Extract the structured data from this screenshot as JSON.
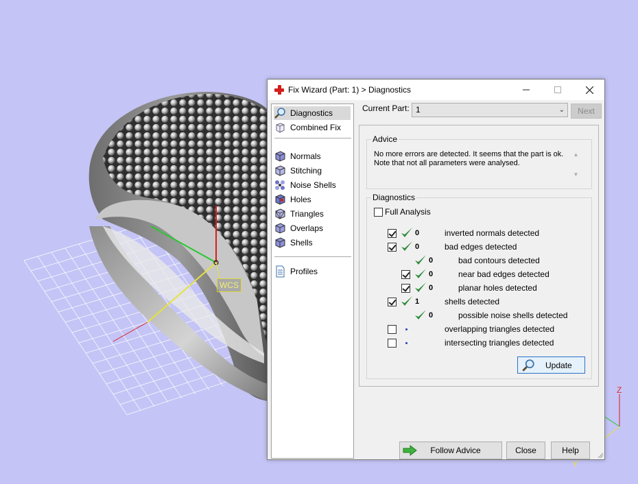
{
  "viewport": {
    "wcs_label": "WCS",
    "axis_z": "Z",
    "axis_y": "Y"
  },
  "dialog": {
    "title": "Fix Wizard (Part: 1) > Diagnostics",
    "icons": {
      "title": "red-cross-icon"
    }
  },
  "nav": {
    "items": [
      {
        "label": "Diagnostics",
        "icon": "magnifier-icon",
        "selected": true
      },
      {
        "label": "Combined Fix",
        "icon": "cube-outline-icon"
      },
      {
        "label": "Normals",
        "icon": "normals-cube-icon"
      },
      {
        "label": "Stitching",
        "icon": "stitching-cube-icon"
      },
      {
        "label": "Noise Shells",
        "icon": "noise-shells-icon"
      },
      {
        "label": "Holes",
        "icon": "holes-cube-icon"
      },
      {
        "label": "Triangles",
        "icon": "triangles-cube-icon"
      },
      {
        "label": "Overlaps",
        "icon": "overlaps-cube-icon"
      },
      {
        "label": "Shells",
        "icon": "shells-cube-icon"
      },
      {
        "label": "Profiles",
        "icon": "document-icon"
      }
    ]
  },
  "current_part": {
    "label": "Current Part:",
    "value": "1"
  },
  "next_label": "Next",
  "advice": {
    "title": "Advice",
    "line1": "No more errors are detected. It seems that the part is ok.",
    "line2": "Note that not all parameters were analysed."
  },
  "diagnostics": {
    "title": "Diagnostics",
    "full_analysis": "Full Analysis",
    "rows": [
      {
        "checked": true,
        "ok": true,
        "count": "0",
        "label": "inverted normals detected"
      },
      {
        "checked": true,
        "ok": true,
        "count": "0",
        "label": "bad edges detected"
      },
      {
        "checked": null,
        "ok": true,
        "count": "0",
        "label": "bad contours detected"
      },
      {
        "checked": true,
        "ok": true,
        "count": "0",
        "label": "near bad edges detected"
      },
      {
        "checked": true,
        "ok": true,
        "count": "0",
        "label": "planar holes detected"
      },
      {
        "checked": true,
        "ok": true,
        "count": "1",
        "label": "shells detected"
      },
      {
        "checked": null,
        "ok": true,
        "count": "0",
        "label": "possible noise shells detected"
      },
      {
        "checked": false,
        "ok": false,
        "count": "",
        "label": "overlapping triangles detected"
      },
      {
        "checked": false,
        "ok": false,
        "count": "",
        "label": "intersecting triangles detected"
      }
    ]
  },
  "buttons": {
    "update": "Update",
    "follow_advice": "Follow Advice",
    "close": "Close",
    "help": "Help"
  },
  "colors": {
    "background": "#c4c4f6",
    "check_green": "#2e8b3a",
    "accent_blue": "#2b72c8"
  }
}
